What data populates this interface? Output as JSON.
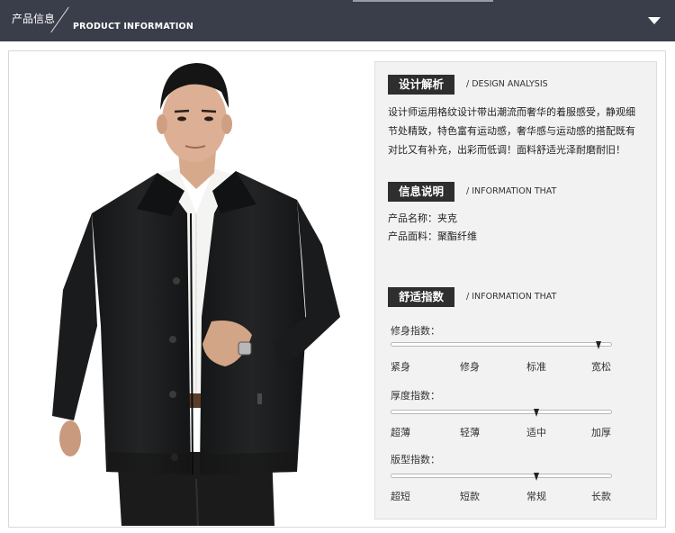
{
  "header": {
    "title_cn": "产品信息",
    "title_en": "PRODUCT INFORMATION"
  },
  "design": {
    "title": "设计解析",
    "subtitle": "/ DESIGN ANALYSIS",
    "lines": [
      "设计师运用格纹设计带出潮流而奢华的着服感受，静观细",
      "节处精致，特色富有运动感，奢华感与运动感的搭配既有",
      "对比又有补充，出彩而低调！面料舒适光泽耐磨耐旧！"
    ]
  },
  "info": {
    "title": "信息说明",
    "subtitle": "/ INFORMATION THAT",
    "name_line": "产品名称：夹克",
    "fabric_line": "产品面料：聚酯纤维"
  },
  "comfort": {
    "title": "舒适指数",
    "subtitle": "/ INFORMATION THAT",
    "scales": [
      {
        "label": "修身指数：",
        "options": [
          "紧身",
          "修身",
          "标准",
          "宽松"
        ],
        "selected_index": 3
      },
      {
        "label": "厚度指数：",
        "options": [
          "超薄",
          "轻薄",
          "适中",
          "加厚"
        ],
        "selected_index": 2
      },
      {
        "label": "版型指数：",
        "options": [
          "超短",
          "短款",
          "常规",
          "长款"
        ],
        "selected_index": 2
      }
    ]
  },
  "colors": {
    "topbar": "#3a3d4a",
    "title_box": "#2e2e2e",
    "panel": "#f2f2f2",
    "jacket": "#1d1e1f"
  }
}
